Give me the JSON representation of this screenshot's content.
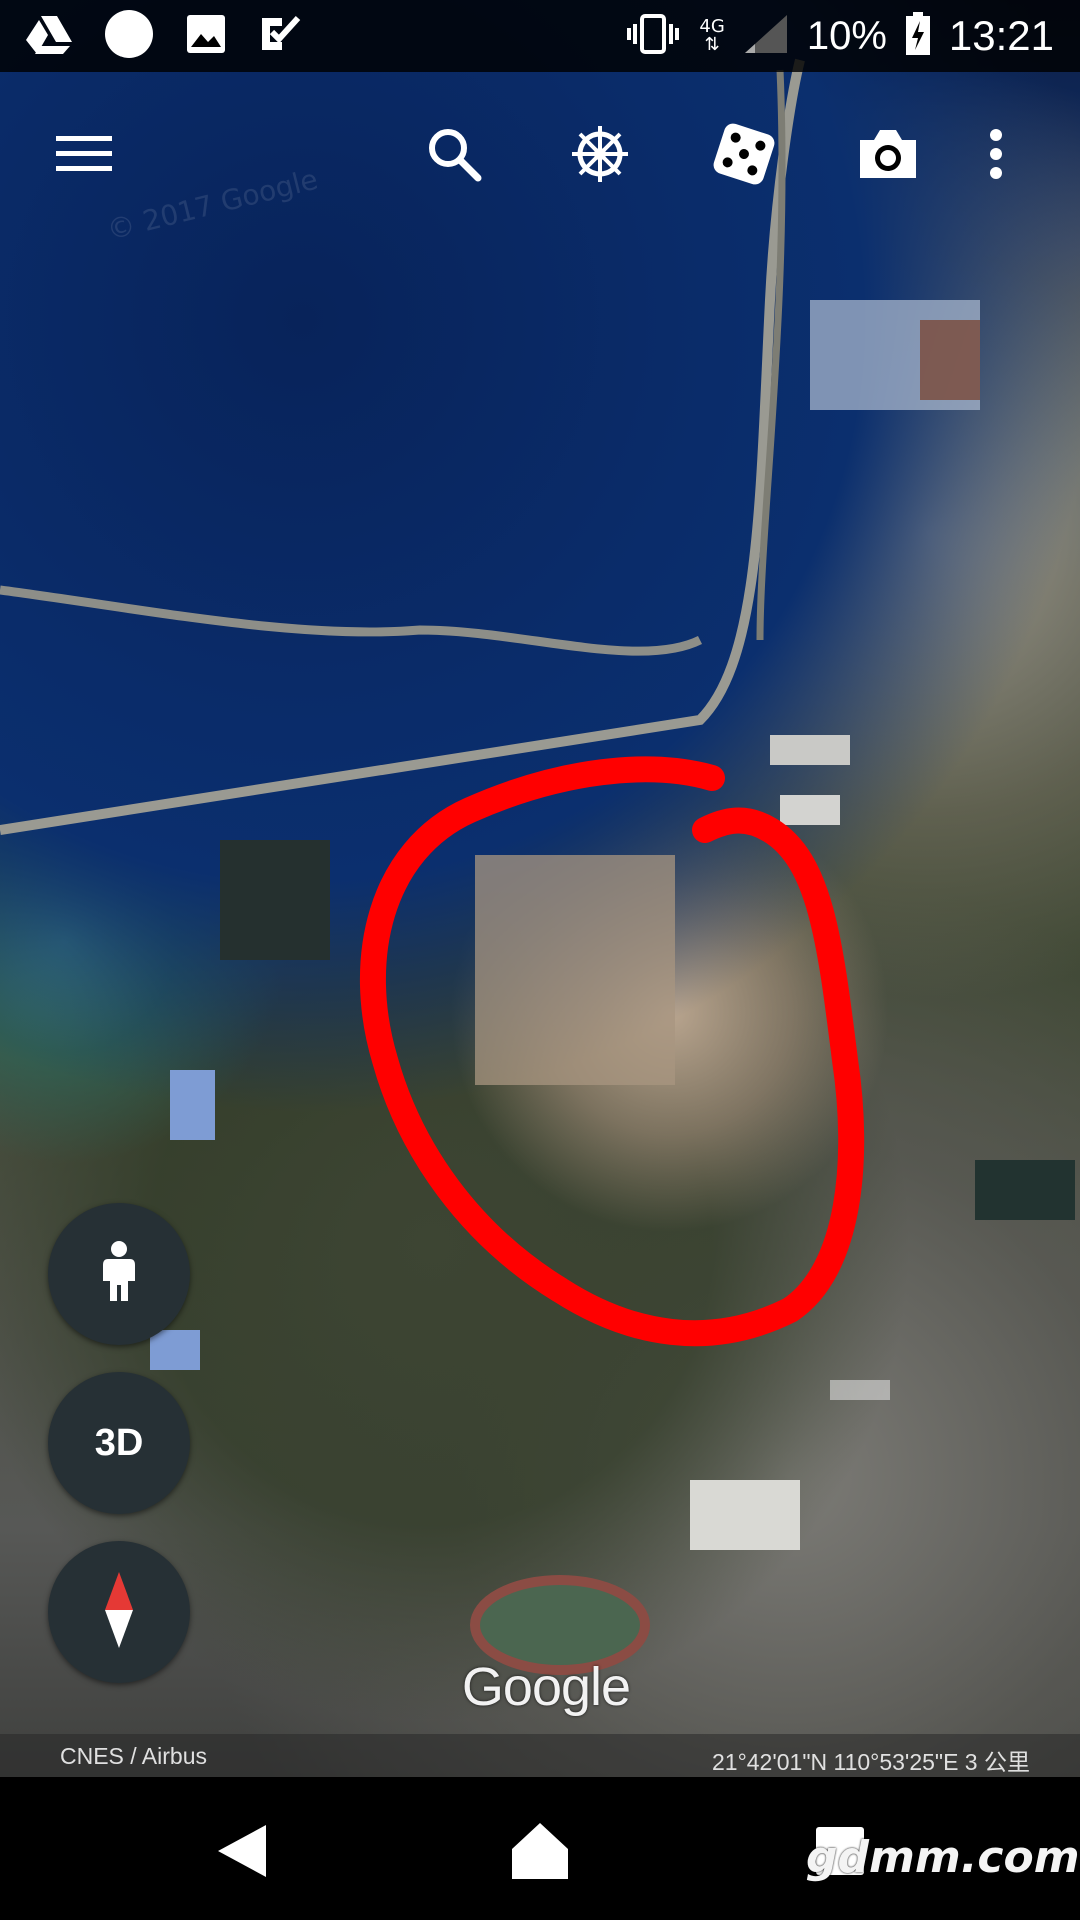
{
  "status_bar": {
    "left_icons": [
      "drive-icon",
      "circle-icon",
      "gallery-icon",
      "tasks-icon"
    ],
    "network_label": "4G",
    "battery_percent": "10%",
    "time": "13:21"
  },
  "toolbar": {
    "icons": [
      "menu-icon",
      "search-icon",
      "voyager-icon",
      "dice-icon",
      "camera-icon",
      "more-icon"
    ]
  },
  "map": {
    "annotation_color": "#ff0000",
    "controls": {
      "street_view_icon": "pegman-icon",
      "three_d_label": "3D",
      "compass_icon": "compass-icon"
    },
    "logo_text": "Google",
    "attribution": "CNES / Airbus",
    "coordinates_scale": "21°42'01\"N 110°53'25\"E 3 公里"
  },
  "nav_bar": {
    "icons": [
      "back-icon",
      "home-icon",
      "recents-icon"
    ]
  },
  "watermark": "gdmm.com"
}
